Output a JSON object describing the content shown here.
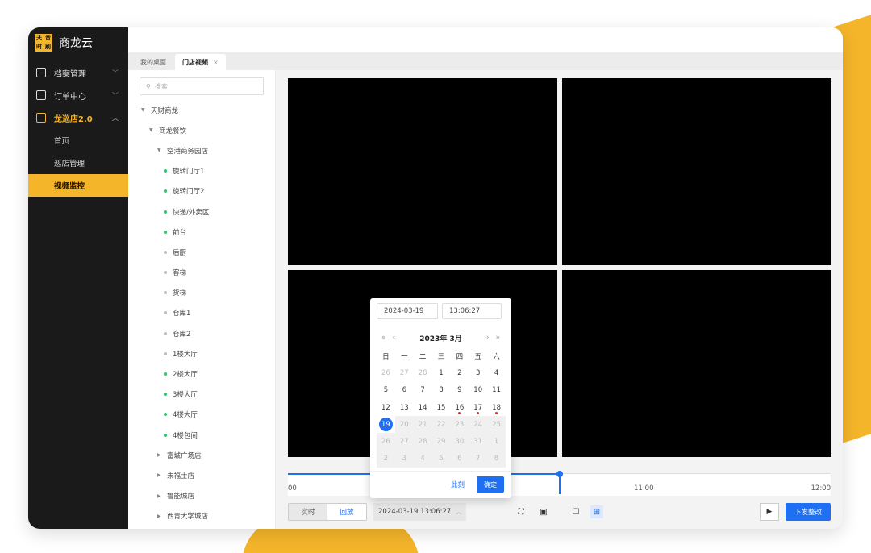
{
  "app": {
    "logo_chars": [
      "天",
      "音",
      "时",
      "刷"
    ],
    "name": "商龙云"
  },
  "sidebar": {
    "items": [
      {
        "label": "档案管理",
        "icon": "archive-icon"
      },
      {
        "label": "订单中心",
        "icon": "order-icon"
      },
      {
        "label": "龙巡店2.0",
        "icon": "patrol-icon"
      }
    ],
    "sub_items": [
      {
        "label": "首页"
      },
      {
        "label": "巡店管理"
      },
      {
        "label": "视频监控"
      }
    ]
  },
  "tabs": [
    {
      "label": "我的桌面"
    },
    {
      "label": "门店视频",
      "close": "×"
    }
  ],
  "tree": {
    "search_placeholder": "搜索",
    "nodes": [
      {
        "label": "天财商龙",
        "level": 0,
        "type": "expanded"
      },
      {
        "label": "商龙餐饮",
        "level": 1,
        "type": "expanded"
      },
      {
        "label": "空港商务园店",
        "level": 2,
        "type": "expanded"
      },
      {
        "label": "旋转门厅1",
        "level": 3,
        "type": "on"
      },
      {
        "label": "旋转门厅2",
        "level": 3,
        "type": "on"
      },
      {
        "label": "快递/外卖区",
        "level": 3,
        "type": "on"
      },
      {
        "label": "前台",
        "level": 3,
        "type": "on"
      },
      {
        "label": "后厨",
        "level": 3,
        "type": "off"
      },
      {
        "label": "客梯",
        "level": 3,
        "type": "off"
      },
      {
        "label": "货梯",
        "level": 3,
        "type": "off"
      },
      {
        "label": "仓库1",
        "level": 3,
        "type": "off"
      },
      {
        "label": "仓库2",
        "level": 3,
        "type": "off"
      },
      {
        "label": "1楼大厅",
        "level": 3,
        "type": "off"
      },
      {
        "label": "2楼大厅",
        "level": 3,
        "type": "on"
      },
      {
        "label": "3楼大厅",
        "level": 3,
        "type": "on"
      },
      {
        "label": "4楼大厅",
        "level": 3,
        "type": "on"
      },
      {
        "label": "4楼包间",
        "level": 3,
        "type": "on"
      },
      {
        "label": "富城广场店",
        "level": 2,
        "type": "collapsed"
      },
      {
        "label": "未福士店",
        "level": 2,
        "type": "collapsed"
      },
      {
        "label": "鲁能城店",
        "level": 2,
        "type": "collapsed"
      },
      {
        "label": "西青大学城店",
        "level": 2,
        "type": "collapsed"
      }
    ]
  },
  "timeline": {
    "labels": [
      "00",
      "11:00",
      "12:00"
    ]
  },
  "controls": {
    "live": "实时",
    "playback": "回放",
    "datetime": "2024-03-19 13:06:27",
    "play": "▶",
    "dispatch": "下发整改"
  },
  "datepicker": {
    "date_value": "2024-03-19",
    "time_value": "13:06:27",
    "title": "2023年 3月",
    "nav_prev_year": "«",
    "nav_prev_month": "‹",
    "nav_next_month": "›",
    "nav_next_year": "»",
    "weekdays": [
      "日",
      "一",
      "二",
      "三",
      "四",
      "五",
      "六"
    ],
    "days": [
      {
        "d": "26",
        "s": "muted"
      },
      {
        "d": "27",
        "s": "muted"
      },
      {
        "d": "28",
        "s": "muted"
      },
      {
        "d": "1",
        "s": ""
      },
      {
        "d": "2",
        "s": ""
      },
      {
        "d": "3",
        "s": ""
      },
      {
        "d": "4",
        "s": ""
      },
      {
        "d": "5",
        "s": ""
      },
      {
        "d": "6",
        "s": ""
      },
      {
        "d": "7",
        "s": ""
      },
      {
        "d": "8",
        "s": ""
      },
      {
        "d": "9",
        "s": ""
      },
      {
        "d": "10",
        "s": ""
      },
      {
        "d": "11",
        "s": ""
      },
      {
        "d": "12",
        "s": ""
      },
      {
        "d": "13",
        "s": ""
      },
      {
        "d": "14",
        "s": ""
      },
      {
        "d": "15",
        "s": ""
      },
      {
        "d": "16",
        "s": "mark"
      },
      {
        "d": "17",
        "s": "mark"
      },
      {
        "d": "18",
        "s": "mark"
      },
      {
        "d": "19",
        "s": "sel"
      },
      {
        "d": "20",
        "s": "dis"
      },
      {
        "d": "21",
        "s": "dis"
      },
      {
        "d": "22",
        "s": "dis"
      },
      {
        "d": "23",
        "s": "dis"
      },
      {
        "d": "24",
        "s": "dis"
      },
      {
        "d": "25",
        "s": "dis"
      },
      {
        "d": "26",
        "s": "dis"
      },
      {
        "d": "27",
        "s": "dis"
      },
      {
        "d": "28",
        "s": "dis"
      },
      {
        "d": "29",
        "s": "dis"
      },
      {
        "d": "30",
        "s": "dis"
      },
      {
        "d": "31",
        "s": "dis"
      },
      {
        "d": "1",
        "s": "dis"
      },
      {
        "d": "2",
        "s": "dis"
      },
      {
        "d": "3",
        "s": "dis"
      },
      {
        "d": "4",
        "s": "dis"
      },
      {
        "d": "5",
        "s": "dis"
      },
      {
        "d": "6",
        "s": "dis"
      },
      {
        "d": "7",
        "s": "dis"
      },
      {
        "d": "8",
        "s": "dis"
      }
    ],
    "now": "此刻",
    "ok": "确定"
  },
  "colors": {
    "accent": "#F5B52A",
    "primary": "#1e6ff1",
    "sidebar": "#1a1a1a"
  }
}
